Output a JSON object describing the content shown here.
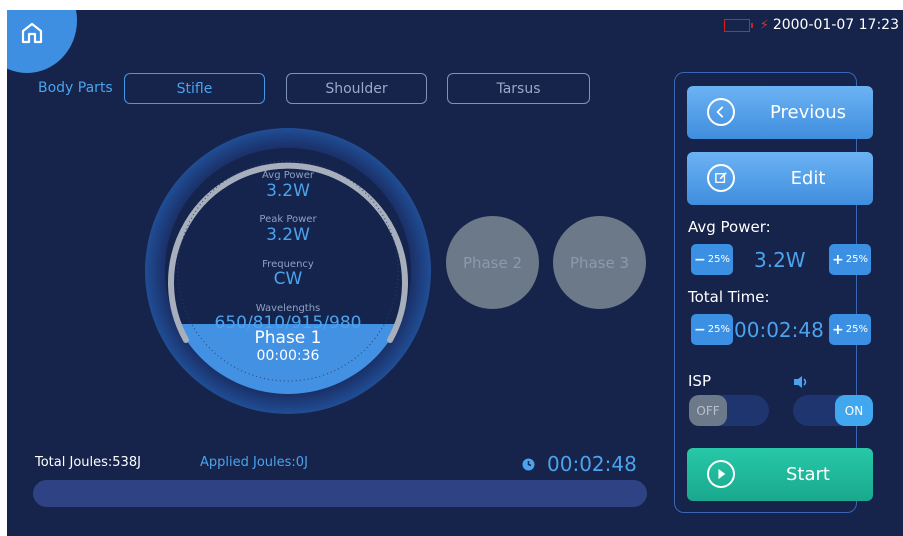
{
  "status": {
    "datetime": "2000-01-07 17:23"
  },
  "body_parts": {
    "label": "Body Parts",
    "options": [
      "Stifle",
      "Shoulder",
      "Tarsus"
    ],
    "selected": "Stifle"
  },
  "dial": {
    "avg_power_label": "Avg Power",
    "avg_power_value": "3.2W",
    "peak_power_label": "Peak Power",
    "peak_power_value": "3.2W",
    "frequency_label": "Frequency",
    "frequency_value": "CW",
    "wavelengths_label": "Wavelengths",
    "wavelengths_value": "650/810/915/980"
  },
  "phases": [
    {
      "name": "Phase 1",
      "time": "00:00:36",
      "active": true
    },
    {
      "name": "Phase 2",
      "active": false
    },
    {
      "name": "Phase 3",
      "active": false
    }
  ],
  "footer": {
    "total_joules": "Total Joules:538J",
    "applied_joules": "Applied Joules:0J",
    "countdown": "00:02:48",
    "progress": 0
  },
  "panel": {
    "previous_label": "Previous",
    "edit_label": "Edit",
    "avg_power_label": "Avg Power:",
    "avg_power_value": "3.2W",
    "total_time_label": "Total Time:",
    "total_time_value": "00:02:48",
    "decrease_label": "25%",
    "increase_label": "25%",
    "isp_label": "ISP",
    "isp_state": "OFF",
    "sound_state": "ON",
    "start_label": "Start"
  },
  "colors": {
    "background": "#16234a",
    "accent": "#4ba3ee",
    "button_blue": "#3f8ddd",
    "start_green": "#1aa88e",
    "inactive_phase": "#6c7989"
  },
  "icons": {
    "home": "home-icon",
    "battery": "battery-icon",
    "charging": "lightning-icon",
    "previous": "chevron-left-circle-icon",
    "edit": "edit-icon",
    "sound": "speaker-icon",
    "clock": "clock-icon",
    "start": "play-circle-icon"
  }
}
